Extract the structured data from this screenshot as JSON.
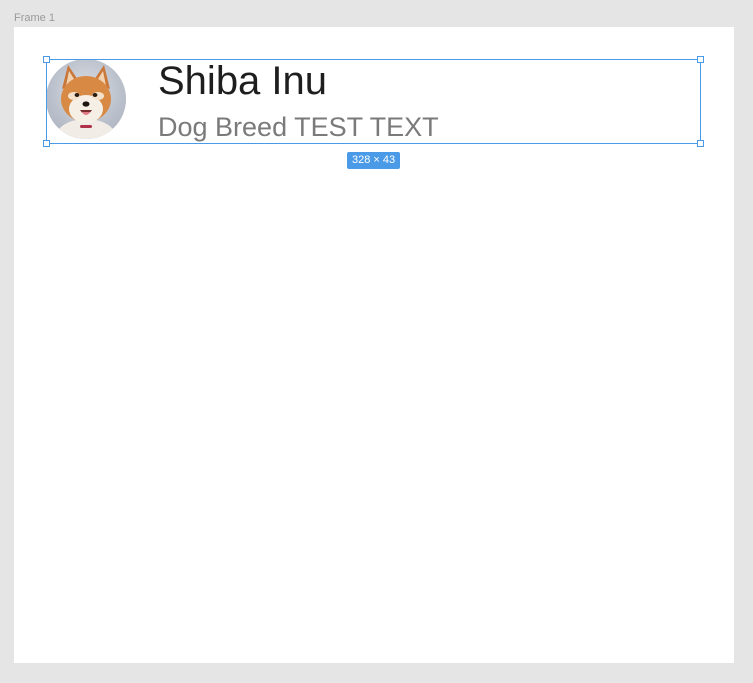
{
  "canvas": {
    "frame_label": "Frame 1"
  },
  "card": {
    "title": "Shiba Inu",
    "subtitle": "Dog Breed TEST TEXT",
    "avatar_alt": "Shiba Inu photo"
  },
  "selection": {
    "size_label": "328 × 43"
  },
  "colors": {
    "canvas_bg": "#e5e5e5",
    "frame_bg": "#ffffff",
    "selection_accent": "#4a9ae8",
    "title_text": "#1e1e1e",
    "subtitle_text": "#7a7a7a"
  }
}
